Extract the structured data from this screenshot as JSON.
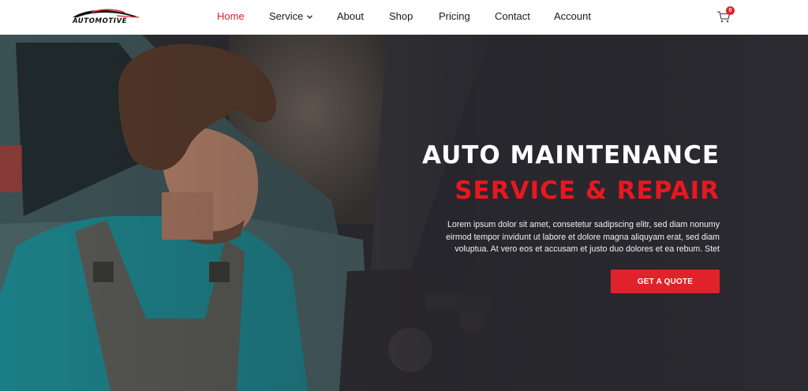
{
  "brand": {
    "logo_text": "AUTOMOTIVE"
  },
  "nav": {
    "items": [
      {
        "label": "Home",
        "active": true
      },
      {
        "label": "Service",
        "has_dropdown": true
      },
      {
        "label": "About"
      },
      {
        "label": "Shop"
      },
      {
        "label": "Pricing"
      },
      {
        "label": "Contact"
      },
      {
        "label": "Account"
      }
    ]
  },
  "cart": {
    "icon": "cart-icon",
    "count": "0"
  },
  "hero": {
    "title_line_1": "AUTO MAINTENANCE",
    "title_line_2": "SERVICE & REPAIR",
    "description": "Lorem ipsum dolor sit amet, consetetur sadipscing elitr, sed diam nonumy eirmod tempor invidunt ut labore et dolore magna aliquyam erat, sed diam voluptua. At vero eos et accusam et justo duo dolores et ea rebum. Stet",
    "cta_label": "GET A QUOTE"
  },
  "colors": {
    "accent": "#e0232b",
    "header_bg": "#ffffff",
    "hero_overlay": "#2a2a30"
  }
}
